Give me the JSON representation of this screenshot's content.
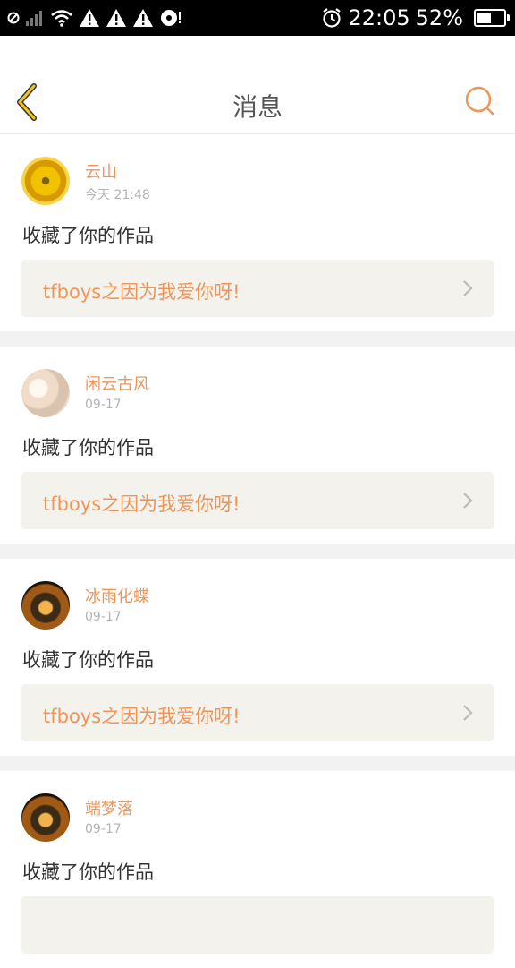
{
  "status_bar": {
    "time": "22:05",
    "battery_percent": "52%",
    "battery_level": 0.52,
    "icons": [
      "sync-icon",
      "signal-icon",
      "wifi-icon",
      "alert-icon",
      "alert-icon",
      "alert-icon",
      "disc-icon",
      "alarm-icon",
      "battery-icon"
    ]
  },
  "header": {
    "title": "消息",
    "back_icon": "chevron-left-icon",
    "search_icon": "search-icon",
    "accent_color": "#f0955a"
  },
  "messages": [
    {
      "user": "云山",
      "time": "今天 21:48",
      "action": "收藏了你的作品",
      "work_title": "tfboys之因为我爱你呀!",
      "avatar": "sunflower-avatar"
    },
    {
      "user": "闲云古风",
      "time": "09-17",
      "action": "收藏了你的作品",
      "work_title": "tfboys之因为我爱你呀!",
      "avatar": "flower-avatar"
    },
    {
      "user": "冰雨化蝶",
      "time": "09-17",
      "action": "收藏了你的作品",
      "work_title": "tfboys之因为我爱你呀!",
      "avatar": "tiger-avatar"
    },
    {
      "user": "端梦落",
      "time": "09-17",
      "action": "收藏了你的作品",
      "work_title": "",
      "avatar": "tiger-avatar"
    }
  ]
}
